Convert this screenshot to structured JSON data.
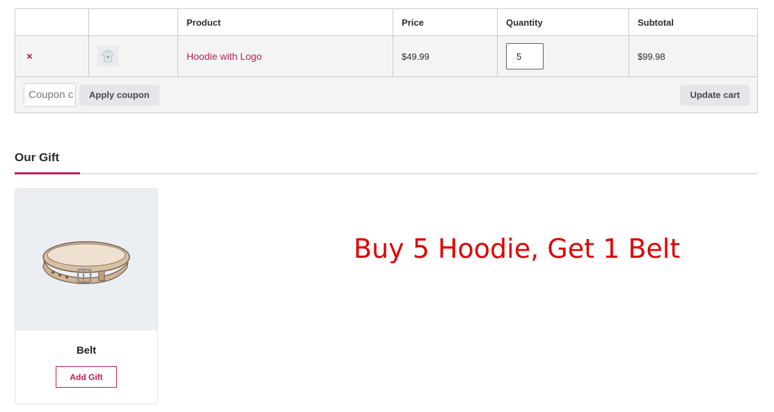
{
  "cart": {
    "headers": {
      "remove": "",
      "thumbnail": "",
      "product": "Product",
      "price": "Price",
      "quantity": "Quantity",
      "subtotal": "Subtotal"
    },
    "item": {
      "remove_icon": "×",
      "thumbnail_icon": "hoodie-icon",
      "product": "Hoodie with Logo",
      "price": "$49.99",
      "quantity": "5",
      "subtotal": "$99.98"
    },
    "coupon_placeholder": "Coupon code",
    "apply_coupon_label": "Apply coupon",
    "update_cart_label": "Update cart"
  },
  "gift": {
    "title": "Our Gift",
    "product_name": "Belt",
    "image_icon": "belt-icon",
    "add_label": "Add Gift"
  },
  "promo_text": "Buy 5 Hoodie, Get 1 Belt",
  "colors": {
    "accent": "#c2185b",
    "link": "#b3225a",
    "promo": "#e00000",
    "remove": "#b3143a"
  }
}
